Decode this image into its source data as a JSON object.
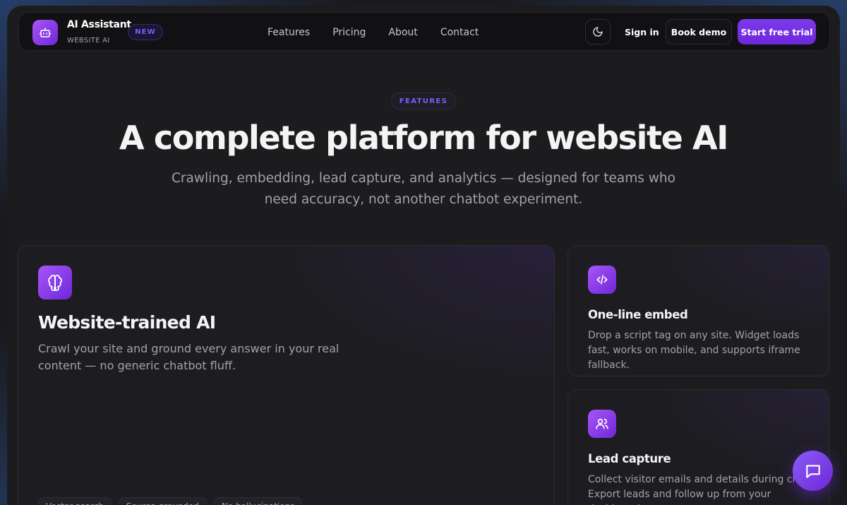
{
  "nav": {
    "brand_title": "AI Assistant",
    "brand_subtitle": "WEBSITE AI",
    "badge": "NEW",
    "links": [
      "Features",
      "Pricing",
      "About",
      "Contact"
    ],
    "sign_in": "Sign in",
    "book_demo": "Book demo",
    "start_trial": "Start free trial",
    "icons": {
      "logo": "robot-icon",
      "theme": "moon-icon"
    }
  },
  "hero": {
    "eyebrow": "FEATURES",
    "title": "A complete platform for website AI",
    "subtitle": "Crawling, embedding, lead capture, and analytics — designed for teams who need accuracy, not another chatbot experiment."
  },
  "cards": {
    "main": {
      "icon": "brain-icon",
      "title": "Website-trained AI",
      "description": "Crawl your site and ground every answer in your real content — no generic chatbot fluff.",
      "chips": [
        "Vector search",
        "Source-grounded",
        "No hallucinations"
      ]
    },
    "embed": {
      "icon": "code-icon",
      "title": "One-line embed",
      "description": "Drop a script tag on any site. Widget loads fast, works on mobile, and supports iframe fallback."
    },
    "lead": {
      "icon": "users-icon",
      "title": "Lead capture",
      "description": "Collect visitor emails and details during chat. Export leads and follow up from your dashboard."
    }
  },
  "chat_widget": {
    "icon": "chat-bubble-icon"
  },
  "colors": {
    "accent": "#7c3aed",
    "accent_light": "#a855f7",
    "background": "#1c1c1f",
    "card": "#1d1d21"
  }
}
